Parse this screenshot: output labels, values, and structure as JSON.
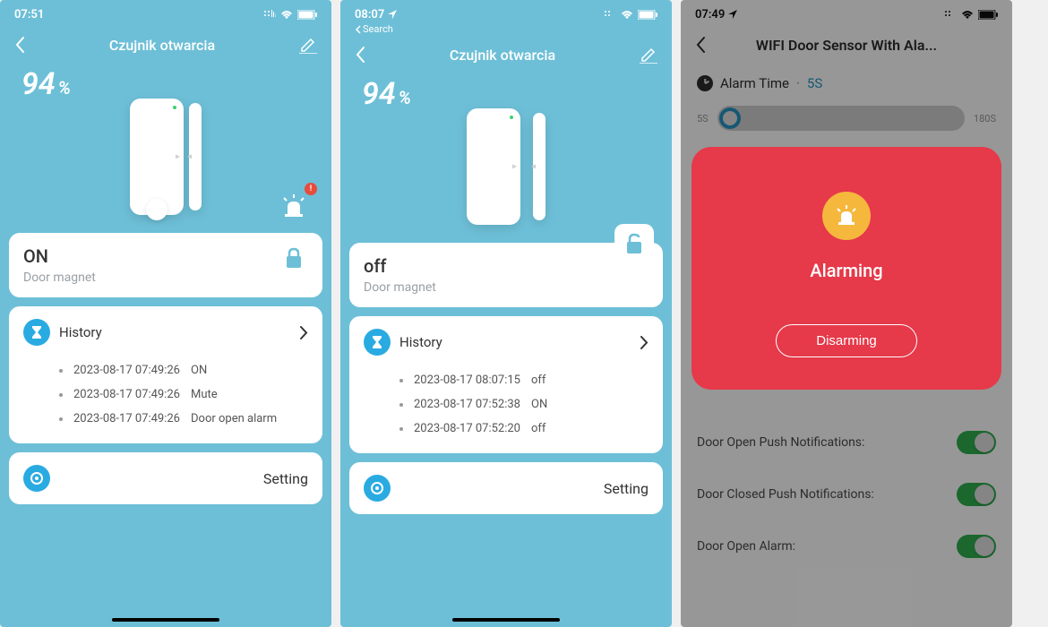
{
  "screen1": {
    "statusbar": {
      "time": "07:51"
    },
    "nav": {
      "title": "Czujnik otwarcia"
    },
    "battery": {
      "value": "94",
      "symbol": "%"
    },
    "alarm_badge": "!",
    "status": {
      "state": "ON",
      "subtitle": "Door magnet"
    },
    "history": {
      "title": "History",
      "rows": [
        {
          "ts": "2023-08-17 07:49:26",
          "val": "ON"
        },
        {
          "ts": "2023-08-17 07:49:26",
          "val": "Mute"
        },
        {
          "ts": "2023-08-17 07:49:26",
          "val": "Door open alarm"
        }
      ]
    },
    "setting": {
      "label": "Setting"
    }
  },
  "screen2": {
    "statusbar": {
      "time": "08:07"
    },
    "back_search": "Search",
    "nav": {
      "title": "Czujnik otwarcia"
    },
    "battery": {
      "value": "94",
      "symbol": "%"
    },
    "status": {
      "state": "off",
      "subtitle": "Door magnet"
    },
    "history": {
      "title": "History",
      "rows": [
        {
          "ts": "2023-08-17 08:07:15",
          "val": "off"
        },
        {
          "ts": "2023-08-17 07:52:38",
          "val": "ON"
        },
        {
          "ts": "2023-08-17 07:52:20",
          "val": "off"
        }
      ]
    },
    "setting": {
      "label": "Setting"
    }
  },
  "screen3": {
    "statusbar": {
      "time": "07:49"
    },
    "nav": {
      "title": "WIFI Door Sensor With Ala..."
    },
    "alarm_time": {
      "label": "Alarm Time",
      "sep": "·",
      "value": "5S"
    },
    "slider": {
      "min_label": "5S",
      "max_label": "180S"
    },
    "alarm": {
      "title": "Alarming",
      "button": "Disarming"
    },
    "toggles": [
      {
        "label": "Door Open Push Notifications:"
      },
      {
        "label": "Door Closed Push Notifications:"
      },
      {
        "label": "Door Open Alarm:"
      }
    ]
  }
}
